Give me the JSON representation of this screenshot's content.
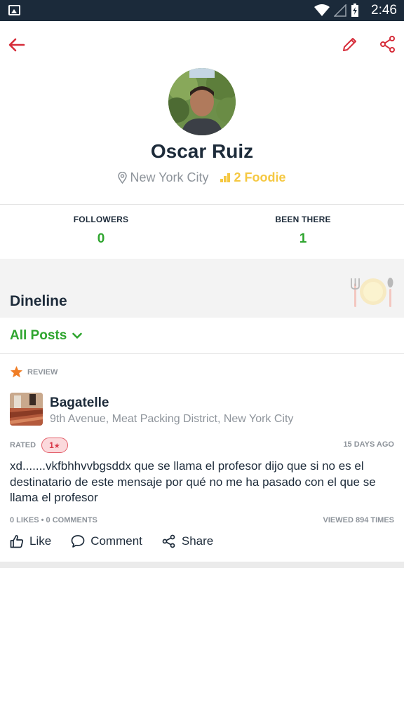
{
  "status_bar": {
    "time": "2:46"
  },
  "profile": {
    "name": "Oscar Ruiz",
    "location": "New York City",
    "rank": "2 Foodie"
  },
  "stats": [
    {
      "label": "FOLLOWERS",
      "value": "0"
    },
    {
      "label": "BEEN THERE",
      "value": "1"
    }
  ],
  "dineline": {
    "title": "Dineline"
  },
  "filter": {
    "label": "All Posts"
  },
  "post": {
    "type": "REVIEW",
    "restaurant": "Bagatelle",
    "address": "9th Avenue, Meat Packing District, New York City",
    "rated_label": "RATED",
    "rating": "1",
    "time_ago": "15 DAYS AGO",
    "text": "xd.......vkfbhhvvbgsddx que se llama el profesor dijo que si no es el destinatario de este mensaje por qué no me ha pasado con el que se llama el profesor",
    "likes": "0 LIKES",
    "comments": "0 COMMENTS",
    "views": "VIEWED 894 TIMES",
    "actions": {
      "like": "Like",
      "comment": "Comment",
      "share": "Share"
    }
  },
  "colors": {
    "accent_red": "#d62d3a",
    "green": "#2fa52f",
    "gold": "#f5c842",
    "dark": "#1d2b3a"
  }
}
